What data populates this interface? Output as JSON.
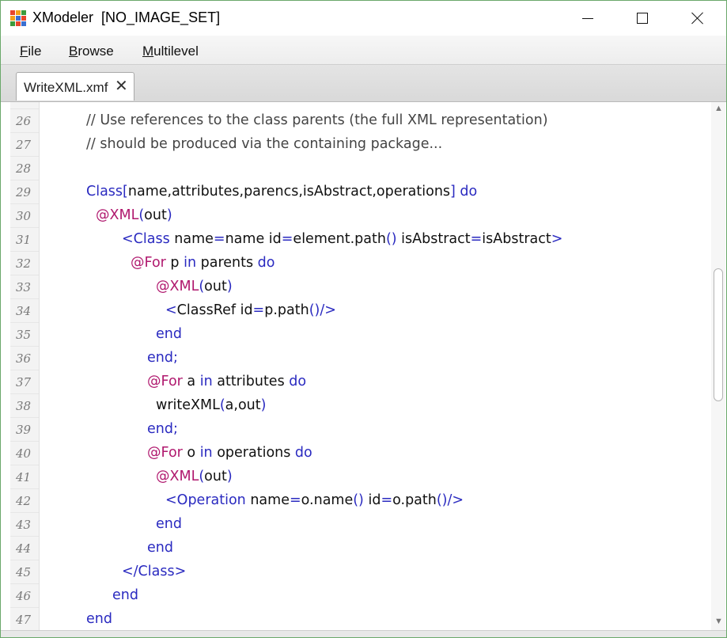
{
  "window": {
    "title": "XModeler  [NO_IMAGE_SET]",
    "icon": "xmodeler-app-icon",
    "controls": {
      "minimize": "minimize-icon",
      "maximize": "maximize-icon",
      "close": "close-icon"
    }
  },
  "menu": {
    "items": [
      {
        "accel": "F",
        "rest": "ile"
      },
      {
        "accel": "B",
        "rest": "rowse"
      },
      {
        "accel": "M",
        "rest": "ultilevel"
      }
    ]
  },
  "tabs": [
    {
      "label": "WriteXML.xmf",
      "close_icon": "close-icon"
    }
  ],
  "editor": {
    "lines": [
      {
        "num": "26",
        "tokens": [
          {
            "t": "// Use references to the class parents (the full XML representation)",
            "k": "c"
          }
        ]
      },
      {
        "num": "27",
        "tokens": [
          {
            "t": "// should be produced via the containing package...",
            "k": "c"
          }
        ]
      },
      {
        "num": "28",
        "tokens": []
      },
      {
        "num": "29",
        "tokens": [
          {
            "t": "Class",
            "k": "k"
          },
          {
            "t": "[",
            "k": "k"
          },
          {
            "t": "name,attributes,parencs,isAbstract,operations",
            "k": "n"
          },
          {
            "t": "]",
            "k": "k"
          },
          {
            "t": " do",
            "k": "k"
          }
        ]
      },
      {
        "num": "30",
        "tokens": [
          {
            "t": "@XML",
            "k": "a"
          },
          {
            "t": "(",
            "k": "k"
          },
          {
            "t": "out",
            "k": "n"
          },
          {
            "t": ")",
            "k": "k"
          }
        ]
      },
      {
        "num": "31",
        "tokens": [
          {
            "t": "<Class",
            "k": "k"
          },
          {
            "t": " name",
            "k": "n"
          },
          {
            "t": "=",
            "k": "k"
          },
          {
            "t": "name id",
            "k": "n"
          },
          {
            "t": "=",
            "k": "k"
          },
          {
            "t": "element.path",
            "k": "n"
          },
          {
            "t": "()",
            "k": "k"
          },
          {
            "t": " isAbstract",
            "k": "n"
          },
          {
            "t": "=",
            "k": "k"
          },
          {
            "t": "isAbstract",
            "k": "n"
          },
          {
            "t": ">",
            "k": "k"
          }
        ]
      },
      {
        "num": "32",
        "tokens": [
          {
            "t": "@For",
            "k": "a"
          },
          {
            "t": " p ",
            "k": "n"
          },
          {
            "t": "in",
            "k": "k"
          },
          {
            "t": " parents ",
            "k": "n"
          },
          {
            "t": "do",
            "k": "k"
          }
        ]
      },
      {
        "num": "33",
        "tokens": [
          {
            "t": "@XML",
            "k": "a"
          },
          {
            "t": "(",
            "k": "k"
          },
          {
            "t": "out",
            "k": "n"
          },
          {
            "t": ")",
            "k": "k"
          }
        ]
      },
      {
        "num": "34",
        "tokens": [
          {
            "t": "<",
            "k": "k"
          },
          {
            "t": "ClassRef id",
            "k": "n"
          },
          {
            "t": "=",
            "k": "k"
          },
          {
            "t": "p.path",
            "k": "n"
          },
          {
            "t": "()/>",
            "k": "k"
          }
        ]
      },
      {
        "num": "35",
        "tokens": [
          {
            "t": "end",
            "k": "k"
          }
        ]
      },
      {
        "num": "36",
        "tokens": [
          {
            "t": "end;",
            "k": "k"
          }
        ]
      },
      {
        "num": "37",
        "tokens": [
          {
            "t": "@For",
            "k": "a"
          },
          {
            "t": " a ",
            "k": "n"
          },
          {
            "t": "in",
            "k": "k"
          },
          {
            "t": " attributes ",
            "k": "n"
          },
          {
            "t": "do",
            "k": "k"
          }
        ]
      },
      {
        "num": "38",
        "tokens": [
          {
            "t": "writeXML",
            "k": "n"
          },
          {
            "t": "(",
            "k": "k"
          },
          {
            "t": "a,out",
            "k": "n"
          },
          {
            "t": ")",
            "k": "k"
          }
        ]
      },
      {
        "num": "39",
        "tokens": [
          {
            "t": "end;",
            "k": "k"
          }
        ]
      },
      {
        "num": "40",
        "tokens": [
          {
            "t": "@For",
            "k": "a"
          },
          {
            "t": " o ",
            "k": "n"
          },
          {
            "t": "in",
            "k": "k"
          },
          {
            "t": " operations ",
            "k": "n"
          },
          {
            "t": "do",
            "k": "k"
          }
        ]
      },
      {
        "num": "41",
        "tokens": [
          {
            "t": "@XML",
            "k": "a"
          },
          {
            "t": "(",
            "k": "k"
          },
          {
            "t": "out",
            "k": "n"
          },
          {
            "t": ")",
            "k": "k"
          }
        ]
      },
      {
        "num": "42",
        "tokens": [
          {
            "t": "<Operation",
            "k": "k"
          },
          {
            "t": " name",
            "k": "n"
          },
          {
            "t": "=",
            "k": "k"
          },
          {
            "t": "o.name",
            "k": "n"
          },
          {
            "t": "()",
            "k": "k"
          },
          {
            "t": " id",
            "k": "n"
          },
          {
            "t": "=",
            "k": "k"
          },
          {
            "t": "o.path",
            "k": "n"
          },
          {
            "t": "()/>",
            "k": "k"
          }
        ]
      },
      {
        "num": "43",
        "tokens": [
          {
            "t": "end",
            "k": "k"
          }
        ]
      },
      {
        "num": "44",
        "tokens": [
          {
            "t": "end",
            "k": "k"
          }
        ]
      },
      {
        "num": "45",
        "tokens": [
          {
            "t": "</Class>",
            "k": "k"
          }
        ]
      },
      {
        "num": "46",
        "tokens": [
          {
            "t": "end",
            "k": "k"
          }
        ]
      },
      {
        "num": "47",
        "tokens": [
          {
            "t": "end",
            "k": "k"
          }
        ]
      }
    ]
  },
  "colors": {
    "keyword": "#2a2ac0",
    "annotation": "#b0186e",
    "comment": "#444444",
    "text": "#111111",
    "gutter_bg": "#f3f3f3",
    "window_border": "#6aa86a"
  },
  "scrollbar": {
    "up_icon": "scroll-up-arrow-icon",
    "down_icon": "scroll-down-arrow-icon"
  }
}
